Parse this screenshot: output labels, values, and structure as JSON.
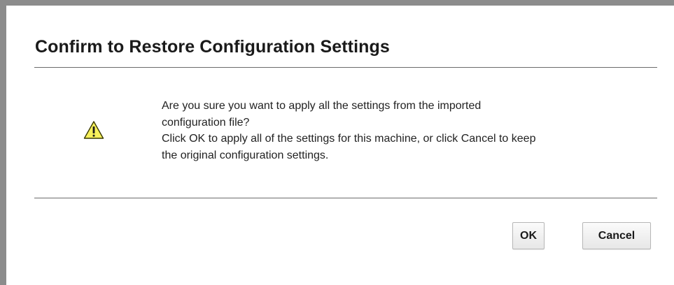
{
  "dialog": {
    "title": "Confirm to Restore Configuration Settings",
    "icon": "warning-triangle-icon",
    "message_lines": [
      "Are you sure you want to apply all the settings from the imported",
      "configuration file?",
      "Click OK to apply all of the settings for this machine, or click Cancel to keep",
      "the original configuration settings."
    ],
    "buttons": {
      "ok_label": "OK",
      "cancel_label": "Cancel"
    }
  },
  "colors": {
    "frame": "#8c8c8c",
    "warning_fill": "#f7f05a",
    "warning_stroke": "#3a3a00",
    "rule": "#6b6b6b"
  }
}
